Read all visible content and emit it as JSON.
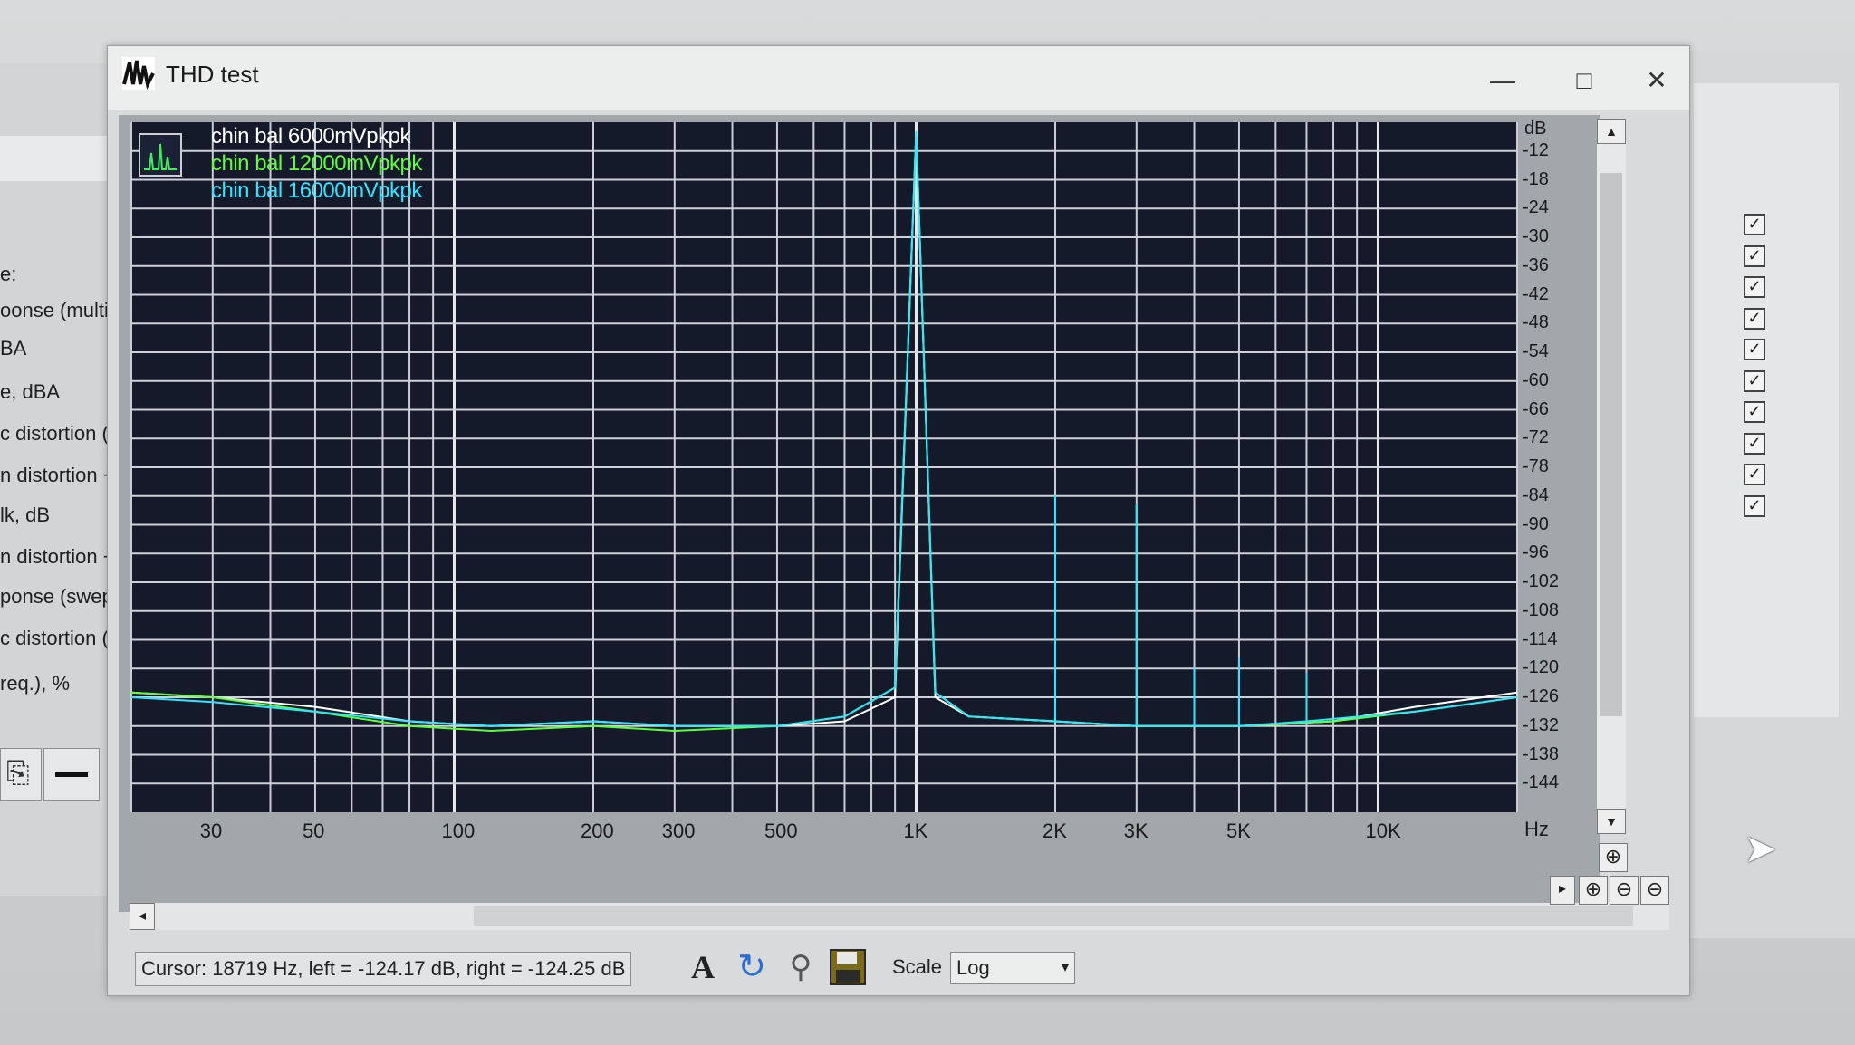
{
  "window": {
    "title": "THD test",
    "minimize_glyph": "—",
    "maximize_glyph": "□",
    "close_glyph": "✕"
  },
  "background": {
    "left_items": [
      "e:",
      "oonse (multito",
      "BA",
      "e, dBA",
      "c distortion (T",
      "n distortion +",
      "lk, dB",
      "n distortion +",
      "ponse (swept",
      "c distortion (sv",
      "req.), %"
    ],
    "checkbox_glyph": "✓",
    "checkbox_count": 10,
    "cursor_icon": "arrow-cursor-icon"
  },
  "plot": {
    "legend": [
      {
        "label": "chin bal  6000mVpkpk",
        "color": "#ffffff"
      },
      {
        "label": "chin bal 12000mVpkpk",
        "color": "#5cff3a"
      },
      {
        "label": "chin bal 16000mVpkpk",
        "color": "#2fe6ff"
      }
    ],
    "y_unit": "dB",
    "x_unit": "Hz",
    "y_ticks": [
      "-12",
      "-18",
      "-24",
      "-30",
      "-36",
      "-42",
      "-48",
      "-54",
      "-60",
      "-66",
      "-72",
      "-78",
      "-84",
      "-90",
      "-96",
      "-102",
      "-108",
      "-114",
      "-120",
      "-126",
      "-132",
      "-138",
      "-144"
    ],
    "x_ticks": [
      "30",
      "50",
      "100",
      "200",
      "300",
      "500",
      "1K",
      "2K",
      "3K",
      "5K",
      "10K"
    ]
  },
  "chart_data": {
    "type": "line",
    "title": "",
    "xlabel": "Hz",
    "ylabel": "dB",
    "x_scale": "log",
    "xlim": [
      20,
      20000
    ],
    "ylim": [
      -150,
      -6
    ],
    "grid": true,
    "legend_position": "top-left",
    "series": [
      {
        "name": "chin bal  6000mVpkpk",
        "color": "#ffffff",
        "points": [
          [
            20,
            -125
          ],
          [
            30,
            -126
          ],
          [
            50,
            -128
          ],
          [
            80,
            -131
          ],
          [
            120,
            -132
          ],
          [
            200,
            -131
          ],
          [
            300,
            -132
          ],
          [
            500,
            -132
          ],
          [
            700,
            -131
          ],
          [
            900,
            -126
          ],
          [
            1000,
            -8
          ],
          [
            1100,
            -126
          ],
          [
            1300,
            -130
          ],
          [
            2000,
            -131
          ],
          [
            3000,
            -132
          ],
          [
            5000,
            -132
          ],
          [
            8000,
            -131
          ],
          [
            12000,
            -128
          ],
          [
            20000,
            -125
          ]
        ]
      },
      {
        "name": "chin bal 12000mVpkpk",
        "color": "#5cff3a",
        "points": [
          [
            20,
            -125
          ],
          [
            30,
            -126
          ],
          [
            50,
            -129
          ],
          [
            80,
            -132
          ],
          [
            120,
            -133
          ],
          [
            200,
            -132
          ],
          [
            300,
            -133
          ],
          [
            500,
            -132
          ],
          [
            700,
            -130
          ],
          [
            900,
            -124
          ],
          [
            1000,
            -8
          ],
          [
            1100,
            -125
          ],
          [
            1300,
            -130
          ],
          [
            2000,
            -131
          ],
          [
            2000,
            -84
          ],
          [
            2000,
            -131
          ],
          [
            3000,
            -132
          ],
          [
            3000,
            -86
          ],
          [
            3000,
            -132
          ],
          [
            5000,
            -132
          ],
          [
            8000,
            -131
          ],
          [
            12000,
            -129
          ],
          [
            20000,
            -126
          ]
        ]
      },
      {
        "name": "chin bal 16000mVpkpk",
        "color": "#2fe6ff",
        "points": [
          [
            20,
            -126
          ],
          [
            30,
            -127
          ],
          [
            50,
            -129
          ],
          [
            80,
            -131
          ],
          [
            120,
            -132
          ],
          [
            200,
            -131
          ],
          [
            300,
            -132
          ],
          [
            500,
            -132
          ],
          [
            700,
            -130
          ],
          [
            900,
            -124
          ],
          [
            1000,
            -8
          ],
          [
            1100,
            -125
          ],
          [
            1300,
            -130
          ],
          [
            2000,
            -131
          ],
          [
            2000,
            -84
          ],
          [
            2000,
            -131
          ],
          [
            3000,
            -132
          ],
          [
            3000,
            -86
          ],
          [
            3000,
            -132
          ],
          [
            4000,
            -132
          ],
          [
            4000,
            -120
          ],
          [
            4000,
            -132
          ],
          [
            5000,
            -132
          ],
          [
            5000,
            -118
          ],
          [
            5000,
            -132
          ],
          [
            7000,
            -131
          ],
          [
            7000,
            -121
          ],
          [
            7000,
            -131
          ],
          [
            12000,
            -129
          ],
          [
            20000,
            -126
          ]
        ]
      }
    ]
  },
  "status": {
    "cursor_text": "Cursor:  18719 Hz,  left = -124.17 dB,  right = -124.25 dB",
    "scale_label": "Scale",
    "scale_value": "Log",
    "dropdown_glyph": "▾",
    "font_tool_glyph": "A",
    "refresh_tool_glyph": "↻",
    "settings_tool_glyph": "⚲",
    "save_tool_glyph": "💾",
    "zoom_in_glyph": "⊕",
    "zoom_out_glyph": "⊖",
    "scroll_up_glyph": "▲",
    "scroll_down_glyph": "▼",
    "scroll_left_glyph": "◂",
    "scroll_right_glyph": "▸"
  }
}
